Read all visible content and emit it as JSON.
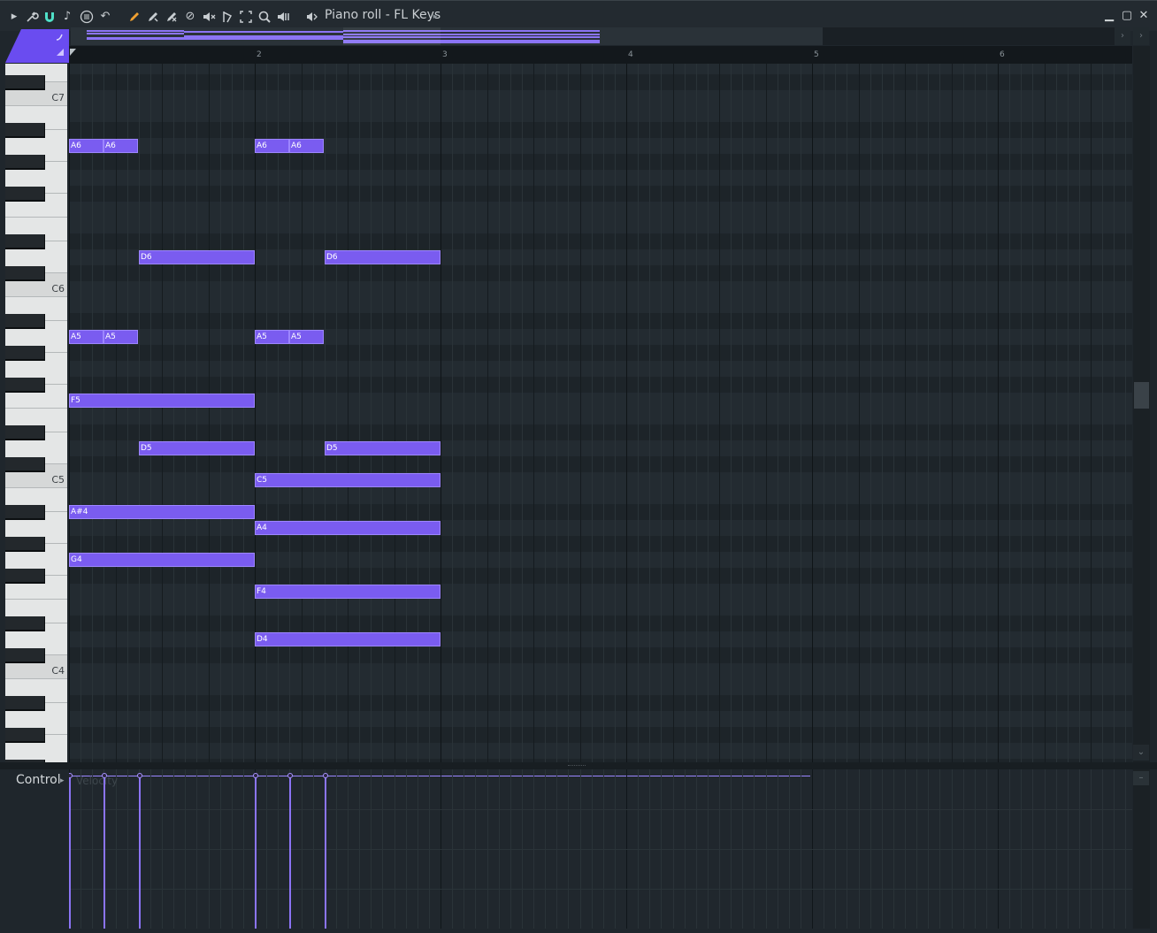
{
  "window": {
    "title": "Piano roll - FL Keys"
  },
  "toolbar": {
    "icons": [
      "menu-arrow-icon",
      "wrench-icon",
      "magnet-icon",
      "note-icon",
      "options-icon",
      "undo-icon",
      "pencil-icon",
      "paint-brush-icon",
      "delete-icon",
      "mute-icon",
      "slice-icon",
      "select-icon",
      "zoom-icon",
      "playback-icon",
      "speaker-icon"
    ]
  },
  "ruler": {
    "bars": [
      "2",
      "3",
      "4",
      "5",
      "6"
    ]
  },
  "keyboard": {
    "labels": [
      "C7",
      "C6",
      "C5",
      "C4"
    ]
  },
  "notes": [
    {
      "label": "A6",
      "start": 0,
      "len": 0.75,
      "pitch": "A6"
    },
    {
      "label": "A6",
      "start": 0.75,
      "len": 0.75,
      "pitch": "A6"
    },
    {
      "label": "A6",
      "start": 4,
      "len": 0.75,
      "pitch": "A6"
    },
    {
      "label": "A6",
      "start": 4.75,
      "len": 0.75,
      "pitch": "A6"
    },
    {
      "label": "D6",
      "start": 1.5,
      "len": 2.5,
      "pitch": "D6"
    },
    {
      "label": "D6",
      "start": 5.5,
      "len": 2.5,
      "pitch": "D6"
    },
    {
      "label": "A5",
      "start": 0,
      "len": 0.75,
      "pitch": "A5"
    },
    {
      "label": "A5",
      "start": 0.75,
      "len": 0.75,
      "pitch": "A5"
    },
    {
      "label": "A5",
      "start": 4,
      "len": 0.75,
      "pitch": "A5"
    },
    {
      "label": "A5",
      "start": 4.75,
      "len": 0.75,
      "pitch": "A5"
    },
    {
      "label": "F5",
      "start": 0,
      "len": 4,
      "pitch": "F5"
    },
    {
      "label": "D5",
      "start": 1.5,
      "len": 2.5,
      "pitch": "D5"
    },
    {
      "label": "D5",
      "start": 5.5,
      "len": 2.5,
      "pitch": "D5"
    },
    {
      "label": "C5",
      "start": 4,
      "len": 4,
      "pitch": "C5"
    },
    {
      "label": "A#4",
      "start": 0,
      "len": 4,
      "pitch": "A#4"
    },
    {
      "label": "A4",
      "start": 4,
      "len": 4,
      "pitch": "A4"
    },
    {
      "label": "G4",
      "start": 0,
      "len": 4,
      "pitch": "G4"
    },
    {
      "label": "F4",
      "start": 4,
      "len": 4,
      "pitch": "F4"
    },
    {
      "label": "D4",
      "start": 4,
      "len": 4,
      "pitch": "D4"
    }
  ],
  "control": {
    "label": "Control",
    "parameter": "Velocity"
  },
  "velocity_events": [
    0,
    0.75,
    1.5,
    4,
    4.75,
    5.5
  ],
  "colors": {
    "note_fill": "#7a5cf0",
    "note_border": "#9d86ff",
    "accent": "#6a4cf0"
  }
}
